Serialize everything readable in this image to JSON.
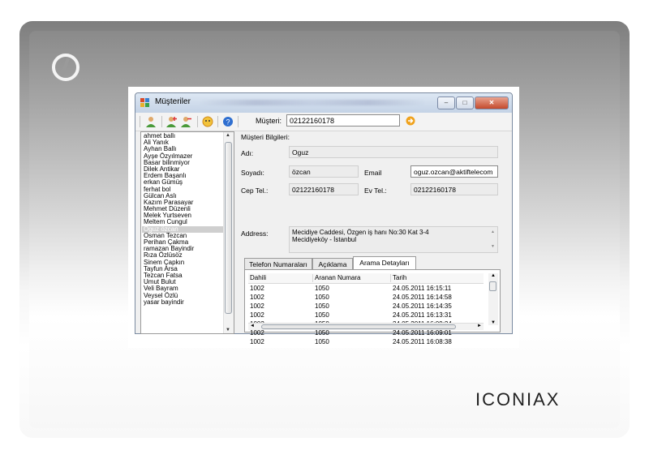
{
  "window": {
    "title": "Müşteriler"
  },
  "toolbar": {
    "musteri_label": "Müşteri:",
    "musteri_value": "02122160178"
  },
  "customers": [
    "ahmet ballı",
    "Ali Yanık",
    "Ayhan Ballı",
    "Ayşe Özyılmazer",
    "Basar bilinmiyor",
    "Dilek Antikar",
    "Erdem Başanlı",
    "erkan Gümüş",
    "ferhat bol",
    "Gülcan Aslı",
    "Kazım Parasayar",
    "Mehmet Düzenli",
    "Melek Yurtseven",
    "Meltem Cungul",
    "Oguz özcan",
    "Osman Tezcan",
    "Perihan Çakma",
    "ramazan Bayindir",
    "Rıza Özlüsöz",
    "Sinem Çapkın",
    "Tayfun Arsa",
    "Tezcan Fatsa",
    "Umut Bulut",
    "Veli Bayram",
    "Veysel Özlü",
    "yasar bayindir"
  ],
  "selected_customer": "Oguz özcan",
  "details": {
    "section_title": "Müşteri Bilgileri:",
    "adi_label": "Adı:",
    "adi_value": "Oguz",
    "soyadi_label": "Soyadı:",
    "soyadi_value": "özcan",
    "email_label": "Email",
    "email_value": "oguz.ozcan@aktiftelecom",
    "cep_label": "Cep Tel.:",
    "cep_value": "02122160178",
    "ev_label": "Ev Tel.:",
    "ev_value": "02122160178",
    "address_label": "Address:",
    "address_line1": "Mecidiye Caddesi, Özgen iş hanı No:30 Kat 3-4",
    "address_line2": "Mecidiyeköy - İstanbul"
  },
  "tabs": [
    "Telefon Numaraları",
    "Açıklama",
    "Arama Detayları"
  ],
  "active_tab": "Arama Detayları",
  "calls": {
    "headers": [
      "Dahili",
      "Aranan Numara",
      "Tarih"
    ],
    "rows": [
      [
        "1002",
        "1050",
        "24.05.2011 16:15:11"
      ],
      [
        "1002",
        "1050",
        "24.05.2011 16:14:58"
      ],
      [
        "1002",
        "1050",
        "24.05.2011 16:14:35"
      ],
      [
        "1002",
        "1050",
        "24.05.2011 16:13:31"
      ],
      [
        "1002",
        "1050",
        "24.05.2011 16:09:24"
      ],
      [
        "1002",
        "1050",
        "24.05.2011 16:09:01"
      ],
      [
        "1002",
        "1050",
        "24.05.2011 16:08:38"
      ]
    ]
  },
  "brand": {
    "name": "ICONIAX",
    "accent_color": "#e07a1f"
  }
}
